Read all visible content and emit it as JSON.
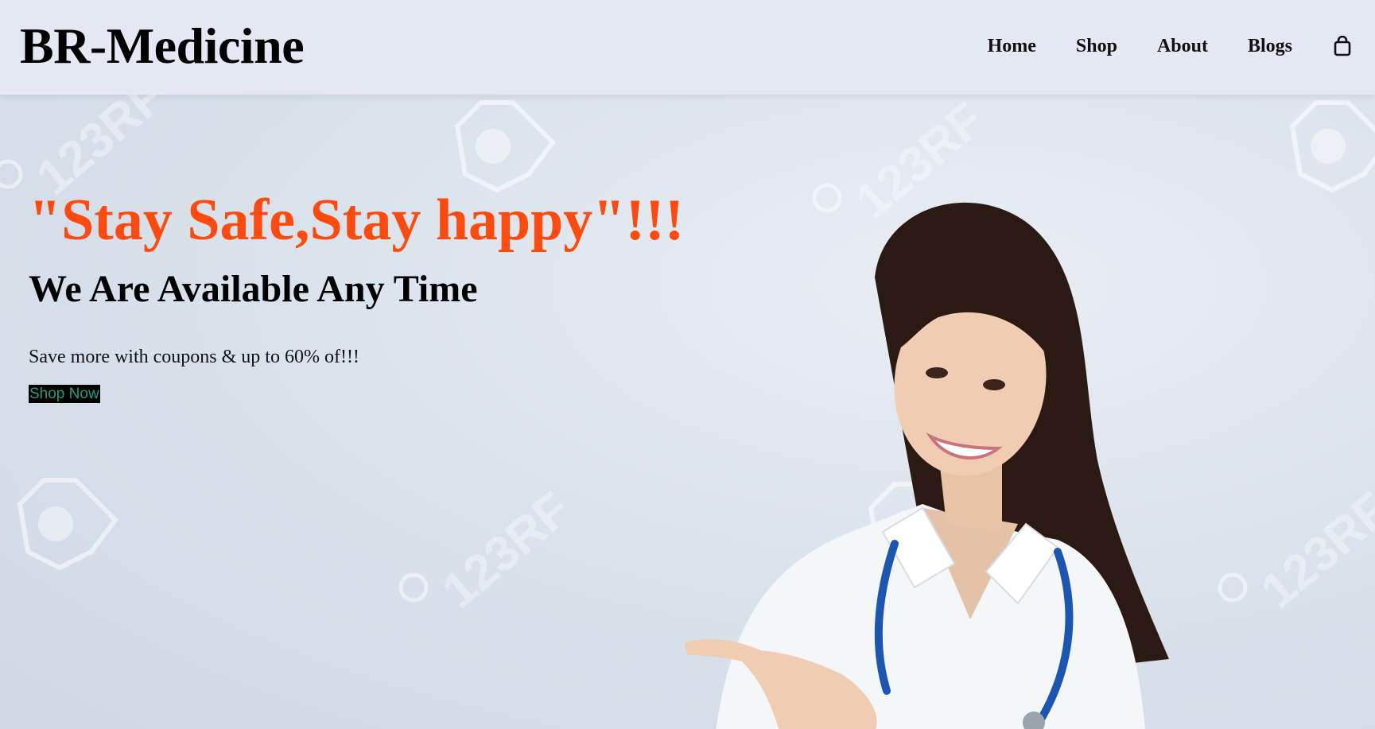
{
  "header": {
    "logo": "BR-Medicine",
    "nav": [
      {
        "label": "Home"
      },
      {
        "label": "Shop"
      },
      {
        "label": "About"
      },
      {
        "label": "Blogs"
      }
    ],
    "cart_icon": "shopping-bag-icon"
  },
  "hero": {
    "slogan": "\"Stay Safe,Stay happy\"!!!",
    "subheading": "We Are Available Any Time",
    "promo": "Save more with coupons & up to 60% of!!!",
    "cta_label": "Shop Now",
    "image": "smiling-doctor-with-stethoscope-pointing",
    "watermark_text": "123RF"
  },
  "colors": {
    "header_bg": "#e3e8f2",
    "slogan": "#ff4a0e",
    "cta_bg": "#000000",
    "cta_text": "#1ea17a",
    "hero_bg": "#dbe3ec"
  }
}
